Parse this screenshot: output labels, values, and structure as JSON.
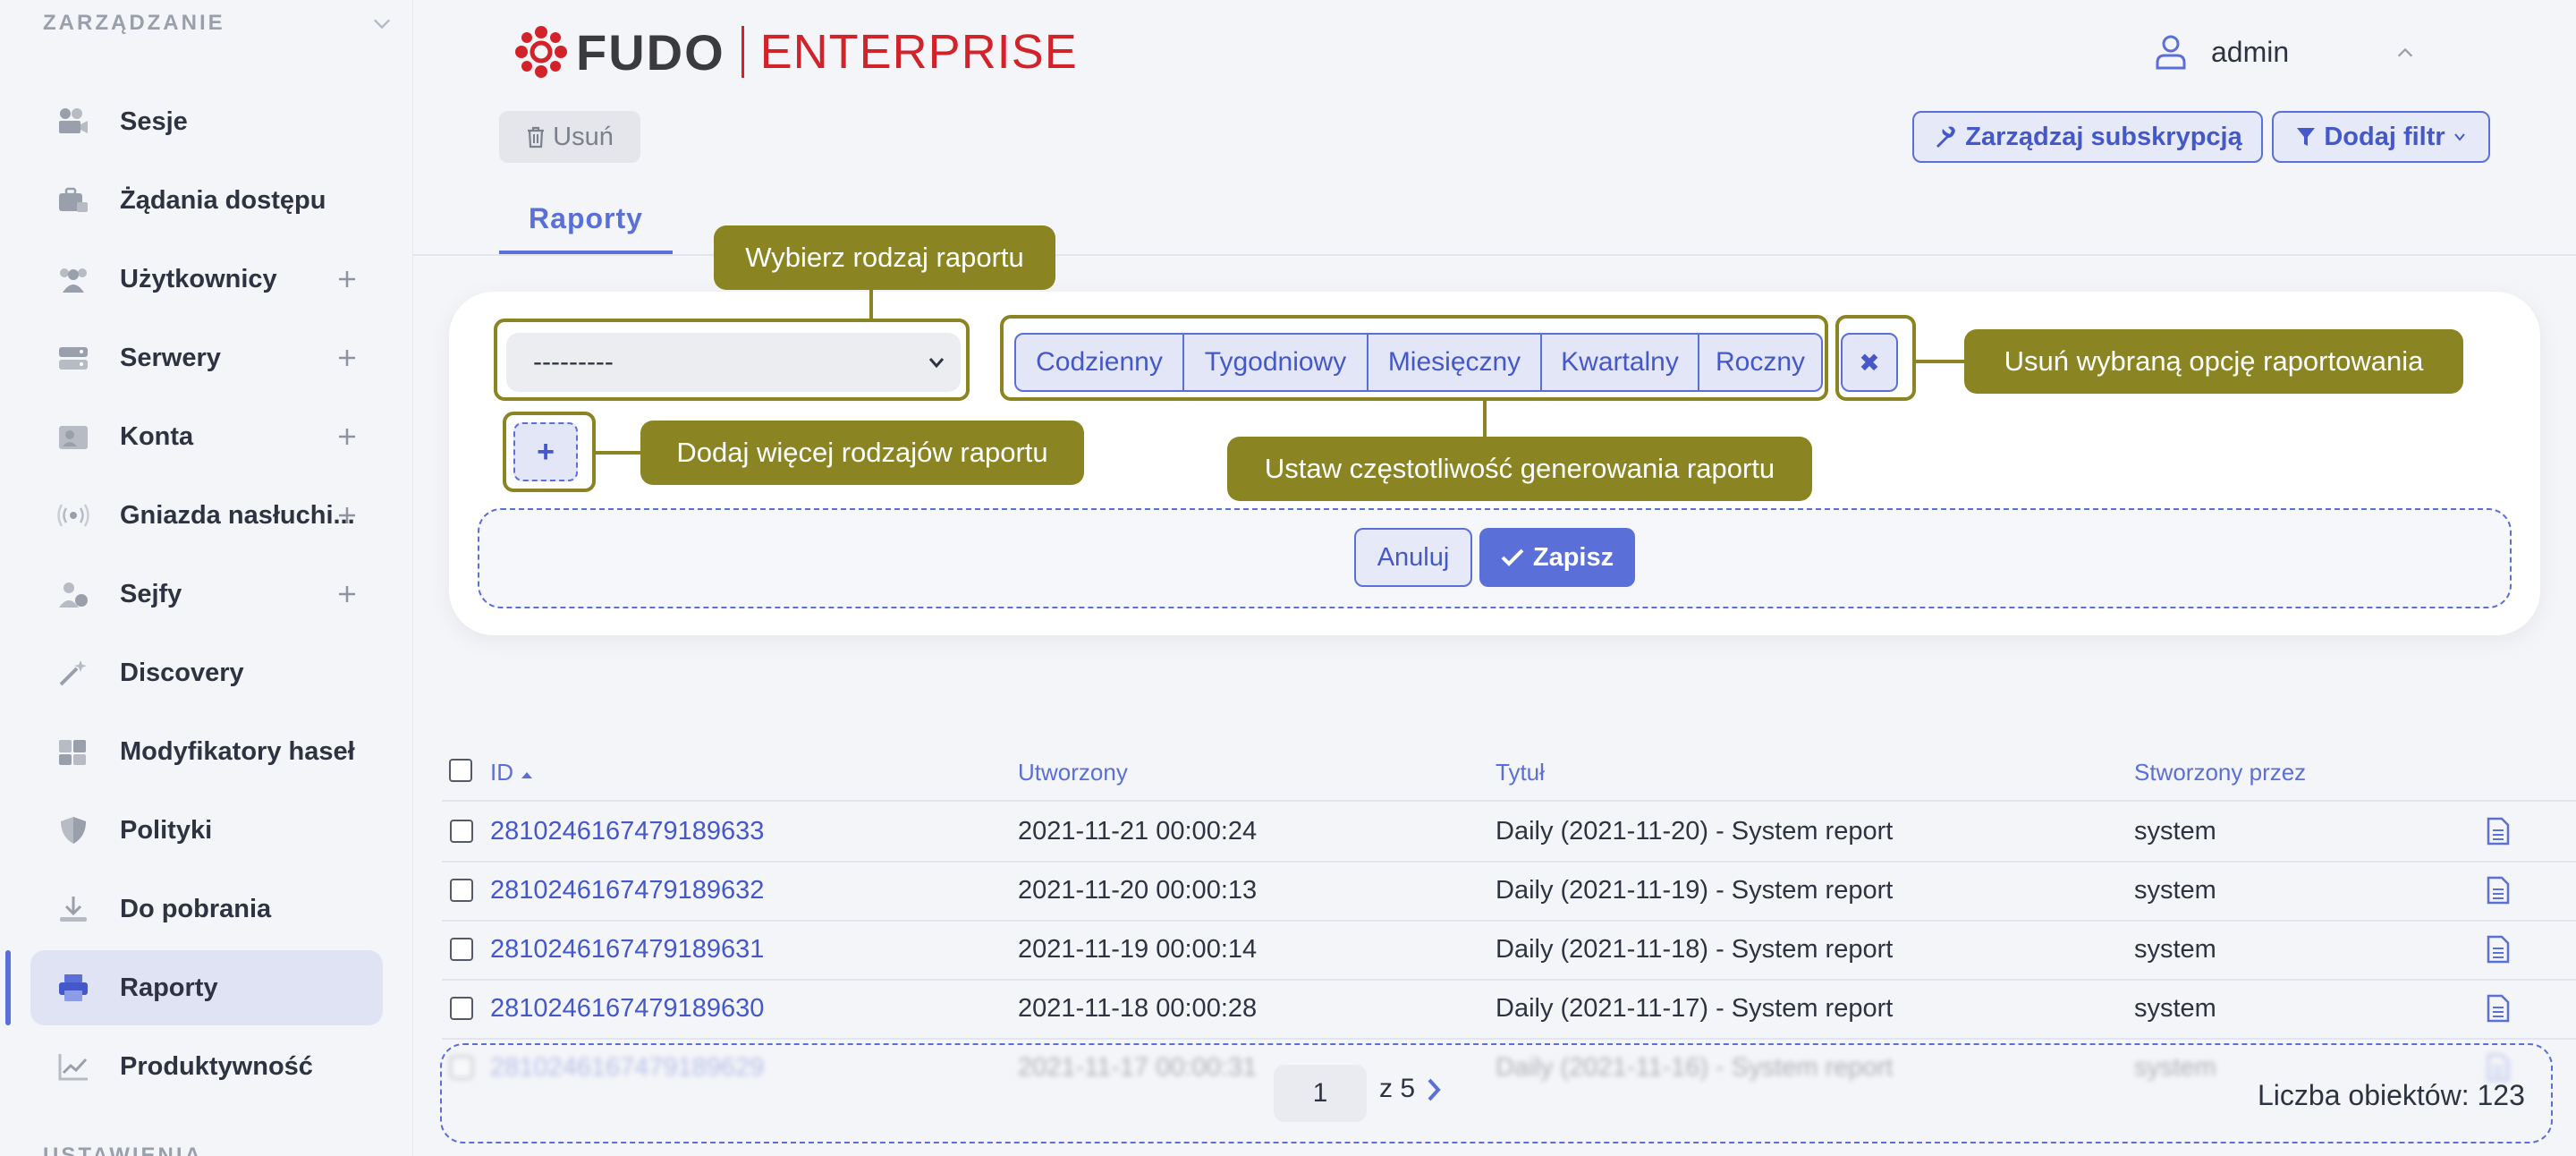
{
  "sidebar": {
    "section_title": "ZARZĄDZANIE",
    "bottom_section": "USTAWIENIA",
    "items": [
      {
        "label": "Sesje",
        "icon": "camera-icon"
      },
      {
        "label": "Żądania dostępu",
        "icon": "briefcase-lock-icon"
      },
      {
        "label": "Użytkownicy",
        "icon": "users-icon"
      },
      {
        "label": "Serwery",
        "icon": "server-icon"
      },
      {
        "label": "Konta",
        "icon": "account-card-icon"
      },
      {
        "label": "Gniazda nasłuchi...",
        "icon": "broadcast-icon"
      },
      {
        "label": "Sejfy",
        "icon": "user-safe-icon"
      },
      {
        "label": "Discovery",
        "icon": "magic-wand-icon"
      },
      {
        "label": "Modyfikatory haseł",
        "icon": "puzzle-icon"
      },
      {
        "label": "Polityki",
        "icon": "shield-icon"
      },
      {
        "label": "Do pobrania",
        "icon": "download-icon"
      },
      {
        "label": "Raporty",
        "icon": "printer-icon"
      },
      {
        "label": "Produktywność",
        "icon": "trend-chart-icon"
      }
    ],
    "active_item": "Raporty"
  },
  "header": {
    "logo_fudo": "FUDO",
    "logo_enterprise": "ENTERPRISE",
    "username": "admin"
  },
  "toolbar": {
    "delete_label": "Usuń",
    "manage_subscription_label": "Zarządzaj subskrypcją",
    "add_filter_label": "Dodaj filtr"
  },
  "tabs": {
    "reports": "Raporty"
  },
  "form": {
    "report_type_value": "---------",
    "frequency_options": [
      "Codzienny",
      "Tygodniowy",
      "Miesięczny",
      "Kwartalny",
      "Roczny"
    ],
    "remove_symbol": "✖",
    "add_symbol": "+",
    "cancel_label": "Anuluj",
    "save_label": "Zapisz"
  },
  "callouts": {
    "choose_type": "Wybierz rodzaj raportu",
    "remove_option": "Usuń wybraną opcję raportowania",
    "add_more": "Dodaj więcej rodzajów raportu",
    "set_frequency": "Ustaw częstotliwość generowania raportu"
  },
  "table": {
    "columns": {
      "id": "ID",
      "created": "Utworzony",
      "title": "Tytuł",
      "created_by": "Stworzony przez"
    },
    "rows": [
      {
        "id": "2810246167479189633",
        "created": "2021-11-21 00:00:24",
        "title": "Daily (2021-11-20) - System report",
        "created_by": "system"
      },
      {
        "id": "2810246167479189632",
        "created": "2021-11-20 00:00:13",
        "title": "Daily (2021-11-19) - System report",
        "created_by": "system"
      },
      {
        "id": "2810246167479189631",
        "created": "2021-11-19 00:00:14",
        "title": "Daily (2021-11-18) - System report",
        "created_by": "system"
      },
      {
        "id": "2810246167479189630",
        "created": "2021-11-18 00:00:28",
        "title": "Daily (2021-11-17) - System report",
        "created_by": "system"
      },
      {
        "id": "2810246167479189629",
        "created": "2021-11-17 00:00:31",
        "title": "Daily (2021-11-16) - System report",
        "created_by": "system"
      }
    ]
  },
  "pagination": {
    "current_page": "1",
    "of_total": "z 5",
    "count_label": "Liczba obiektów: 123"
  },
  "colors": {
    "accent": "#5a6fd8",
    "callout": "#8a8522",
    "brand_red": "#d2232a"
  }
}
